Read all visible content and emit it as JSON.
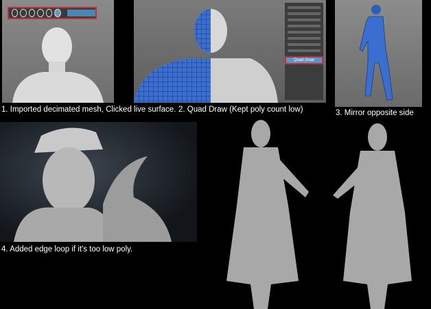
{
  "panels": [
    {
      "caption": "1. Imported decimated mesh, Clicked live surface."
    },
    {
      "caption": "2. Quad Draw (Kept poly count low)",
      "tool_label": "Quad Draw"
    },
    {
      "caption": "3. Mirror opposite side"
    },
    {
      "caption": "4. Added edge loop if it's too low poly."
    },
    {
      "caption": ""
    }
  ],
  "colors": {
    "background": "#000000",
    "mesh_blue": "#3a6fd0",
    "highlight_red": "#c0303a",
    "ui_blue": "#4a87b5"
  }
}
